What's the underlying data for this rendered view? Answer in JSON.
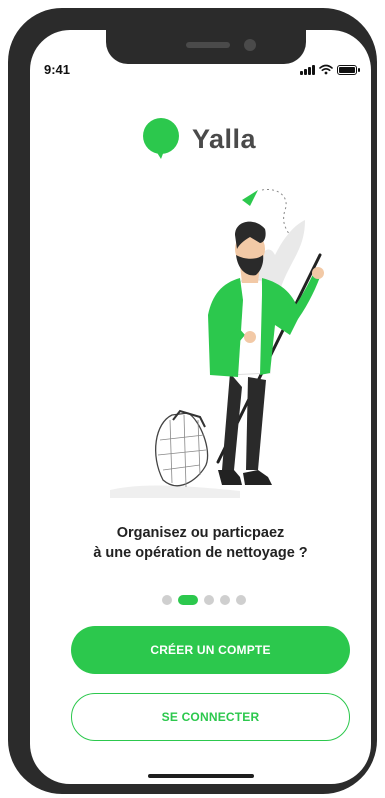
{
  "status_bar": {
    "time": "9:41",
    "signal_icon": "cellular-signal-icon",
    "wifi_icon": "wifi-icon",
    "battery_icon": "battery-icon"
  },
  "app": {
    "name": "Yalla",
    "logo_icon": "speech-bubble-logo-icon",
    "brand_color": "#2cc84d",
    "text_color": "#4a4a4a"
  },
  "onboarding": {
    "illustration": "man-with-litter-net-illustration",
    "tagline_line1": "Organisez ou particpaez",
    "tagline_line2": "à une opération de nettoyage ?",
    "page_count": 5,
    "active_page": 2
  },
  "actions": {
    "create_account_label": "CRÉER UN COMPTE",
    "login_label": "SE CONNECTER"
  }
}
